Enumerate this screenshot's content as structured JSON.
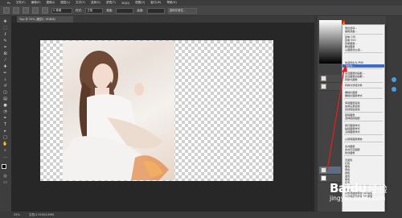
{
  "menubar": {
    "items": [
      "Ps",
      "文件(F)",
      "编辑(E)",
      "图像(I)",
      "图层(L)",
      "文字(Y)",
      "选择(S)",
      "滤镜(T)",
      "3D(D)",
      "视图(V)",
      "窗口(W)",
      "帮助(H)"
    ]
  },
  "options": {
    "field1": "0 像素",
    "label_style": "样式:",
    "style_value": "正常",
    "label_width": "宽度:",
    "label_height": "高度:",
    "button": "选择并遮住..."
  },
  "document": {
    "tab_title": "Ypp @ 25% (图层1, RGB/8)"
  },
  "status": {
    "zoom": "25%",
    "doc_info": "文档:2.91M/3.89M"
  },
  "context_menu": {
    "items": [
      "混合选项...",
      "编辑调整...",
      "复制 CSS",
      "复制 SVG",
      "复制图层...",
      "删除图层",
      "从图层建立组...",
      "快速导出为 PNG",
      "导出为...",
      "来自图层的画板...",
      "来自图层的画框...",
      "转换为图框",
      "转换为智能对象",
      "栅格化图层",
      "栅格化图层样式",
      "停用图层蒙版",
      "启用矢量蒙版",
      "创建剪贴蒙版",
      "链接图层",
      "选择链接图层",
      "拷贝图层样式",
      "粘贴图层样式",
      "清除图层样式",
      "从隔离图层释放",
      "合并图层",
      "合并可见图层",
      "拼合图像",
      "无颜色",
      "红色",
      "橙色",
      "黄色",
      "绿色",
      "蓝色",
      "紫色",
      "灰色",
      "明信片",
      "从所选图层新建 3D 模型",
      "从当前选区新建 3D 模型"
    ],
    "highlighted_index": 8
  },
  "watermark": {
    "brand": "Baidu",
    "suffix": "经验",
    "url": "jingyan.baidu.com"
  },
  "colors": {
    "highlight": "#3a6cc9",
    "arrow": "#e02020"
  }
}
